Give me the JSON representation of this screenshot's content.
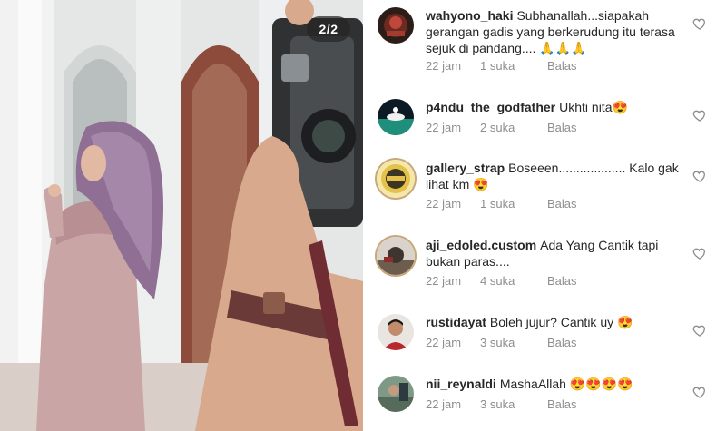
{
  "post": {
    "image_counter": "2/2"
  },
  "comments": [
    {
      "username": "wahyono_haki",
      "text": "Subhanallah...siapakah gerangan gadis yang berkerudung itu terasa sejuk di pandang....",
      "emoji": "🙏🙏🙏",
      "time": "22 jam",
      "likes": "1 suka",
      "reply": "Balas"
    },
    {
      "username": "p4ndu_the_godfather",
      "text": "Ukhti nita",
      "emoji": "😍",
      "time": "22 jam",
      "likes": "2 suka",
      "reply": "Balas"
    },
    {
      "username": "gallery_strap",
      "text": "Boseeen................... Kalo gak lihat km",
      "emoji": "😍",
      "time": "22 jam",
      "likes": "1 suka",
      "reply": "Balas"
    },
    {
      "username": "aji_edoled.custom",
      "text": "Ada Yang Cantik tapi bukan paras....",
      "emoji": "",
      "time": "22 jam",
      "likes": "4 suka",
      "reply": "Balas"
    },
    {
      "username": "rustidayat",
      "text": "Boleh jujur? Cantik uy",
      "emoji": "😍",
      "time": "22 jam",
      "likes": "3 suka",
      "reply": "Balas"
    },
    {
      "username": "nii_reynaldi",
      "text": "MashaAllah",
      "emoji": "😍😍😍😍",
      "time": "22 jam",
      "likes": "3 suka",
      "reply": "Balas"
    }
  ],
  "icons": {
    "like": "heart-outline-icon"
  },
  "colors": {
    "text": "#262626",
    "muted": "#8e8e8e"
  }
}
